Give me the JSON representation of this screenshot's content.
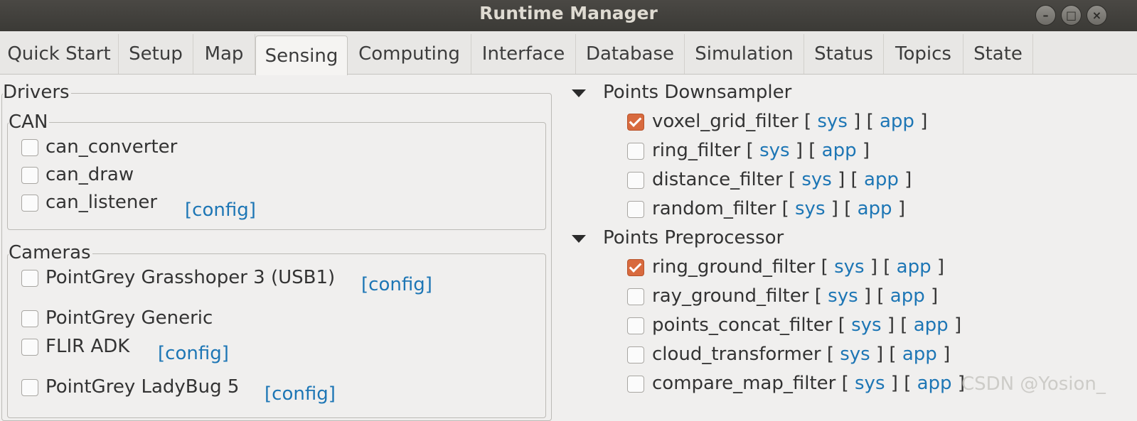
{
  "window": {
    "title": "Runtime Manager"
  },
  "tabs": [
    "Quick Start",
    "Setup",
    "Map",
    "Sensing",
    "Computing",
    "Interface",
    "Database",
    "Simulation",
    "Status",
    "Topics",
    "State"
  ],
  "drivers": {
    "label": "Drivers",
    "can": {
      "label": "CAN",
      "items": [
        "can_converter",
        "can_draw",
        "can_listener"
      ],
      "config": "[config]"
    },
    "cameras": {
      "label": "Cameras",
      "items": [
        "PointGrey Grasshoper 3 (USB1)",
        "PointGrey Generic",
        "FLIR ADK",
        "PointGrey LadyBug 5"
      ],
      "config": "[config]"
    }
  },
  "downsampler": {
    "label": "Points Downsampler",
    "items": [
      "voxel_grid_filter",
      "ring_filter",
      "distance_filter",
      "random_filter"
    ]
  },
  "preprocessor": {
    "label": "Points Preprocessor",
    "items": [
      "ring_ground_filter",
      "ray_ground_filter",
      "points_concat_filter",
      "cloud_transformer",
      "compare_map_filter"
    ]
  },
  "links": {
    "open": "[",
    "close": "]",
    "sys": "sys",
    "app": "app"
  },
  "watermark": "CSDN @Yosion_"
}
